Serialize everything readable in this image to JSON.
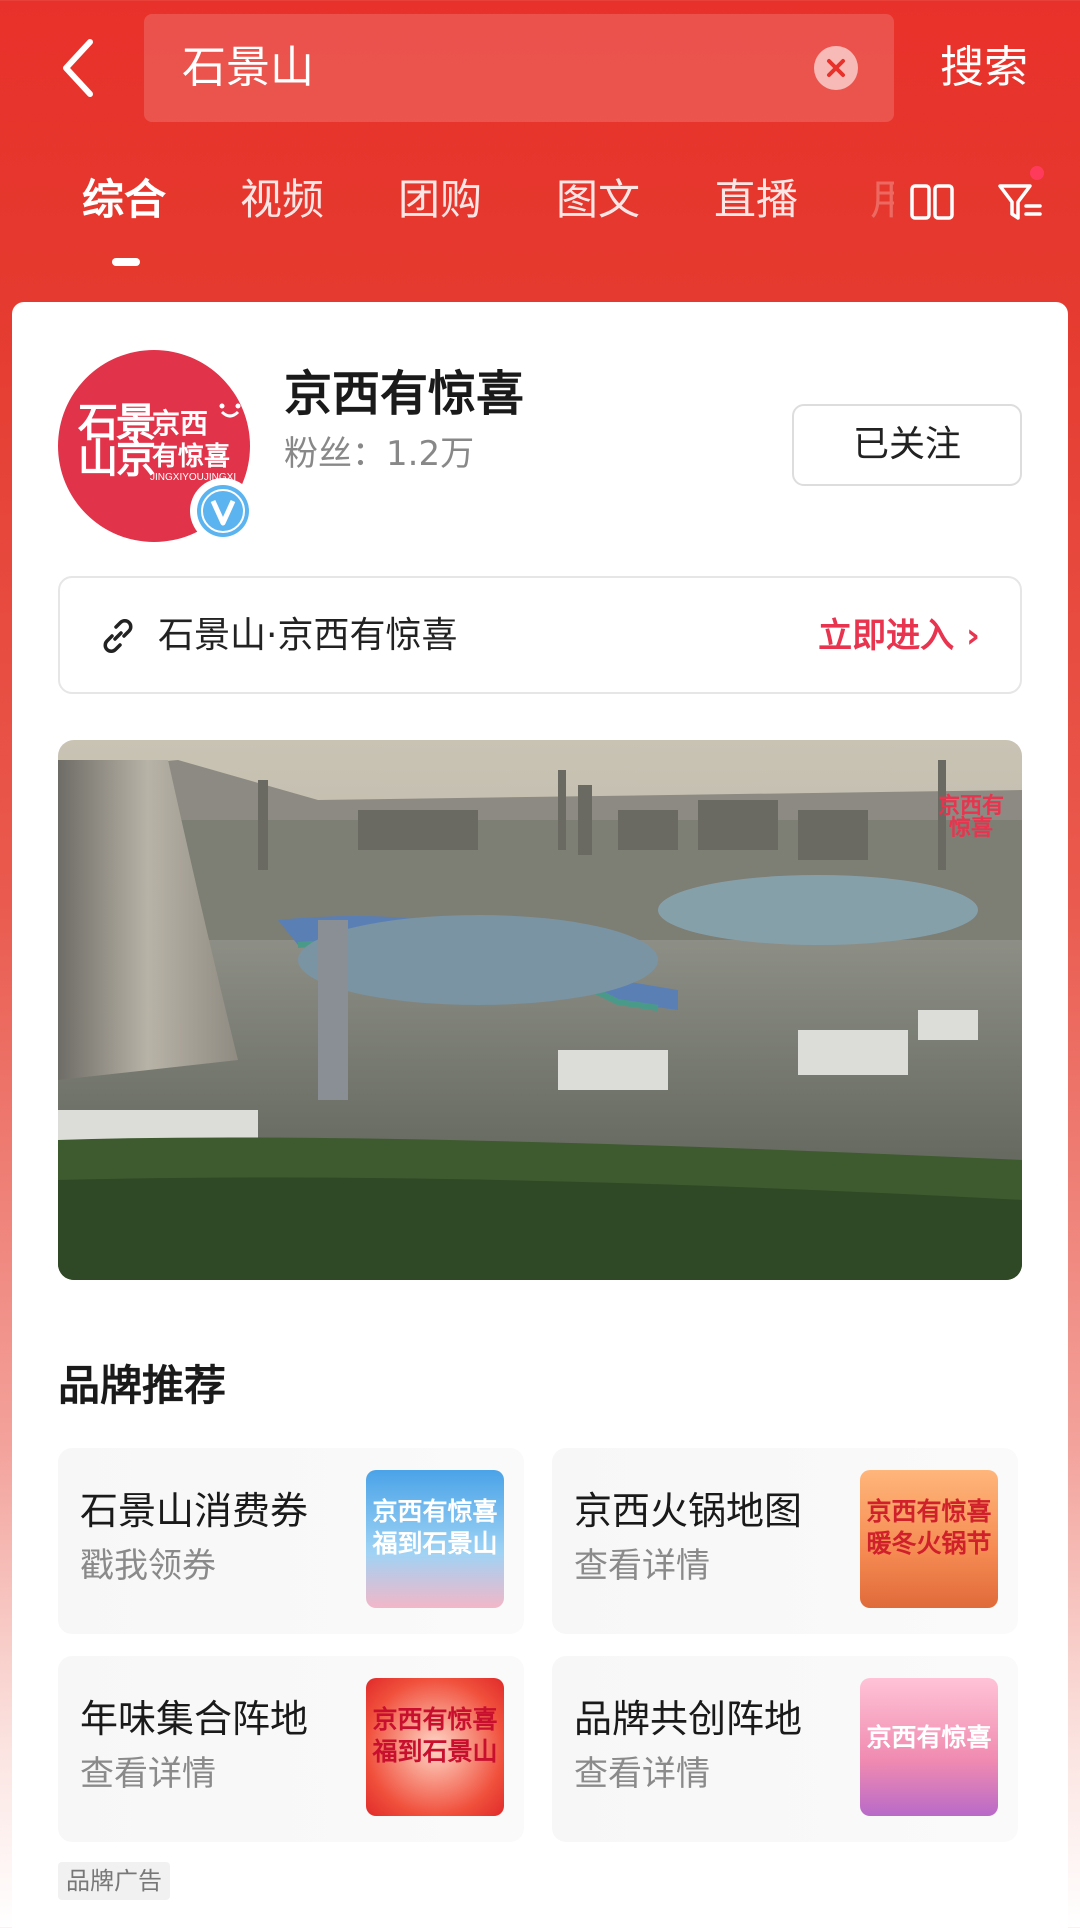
{
  "header": {
    "search_query": "石景山",
    "search_button": "搜索"
  },
  "tabs": {
    "items": [
      "综合",
      "视频",
      "团购",
      "图文",
      "直播"
    ],
    "partial": "用",
    "active_index": 0
  },
  "account": {
    "avatar_text_main": "京西",
    "avatar_text_sub": "有惊喜",
    "avatar_text_pinyin": "JINGXIYOUJINGXI",
    "name": "京西有惊喜",
    "fans_label": "粉丝：",
    "fans_value": "1.2万",
    "follow_button": "已关注"
  },
  "link_bar": {
    "text": "石景山·京西有惊喜",
    "action": "立即进入"
  },
  "video": {
    "watermark": "京西有惊喜"
  },
  "brand_section": {
    "title": "品牌推荐",
    "tiles": [
      {
        "title": "石景山消费券",
        "subtitle": "戳我领券",
        "image_text": "京西有惊喜 福到石景山"
      },
      {
        "title": "京西火锅地图",
        "subtitle": "查看详情",
        "image_text": "京西有惊喜 暖冬火锅节"
      },
      {
        "title": "年味集合阵地",
        "subtitle": "查看详情",
        "image_text": "京西有惊喜 福到石景山"
      },
      {
        "title": "品牌共创阵地",
        "subtitle": "查看详情",
        "image_text": "京西有惊喜"
      }
    ],
    "ad_label": "品牌广告"
  },
  "colors": {
    "brand_red": "#e8312a",
    "accent_pink": "#e8344e"
  }
}
